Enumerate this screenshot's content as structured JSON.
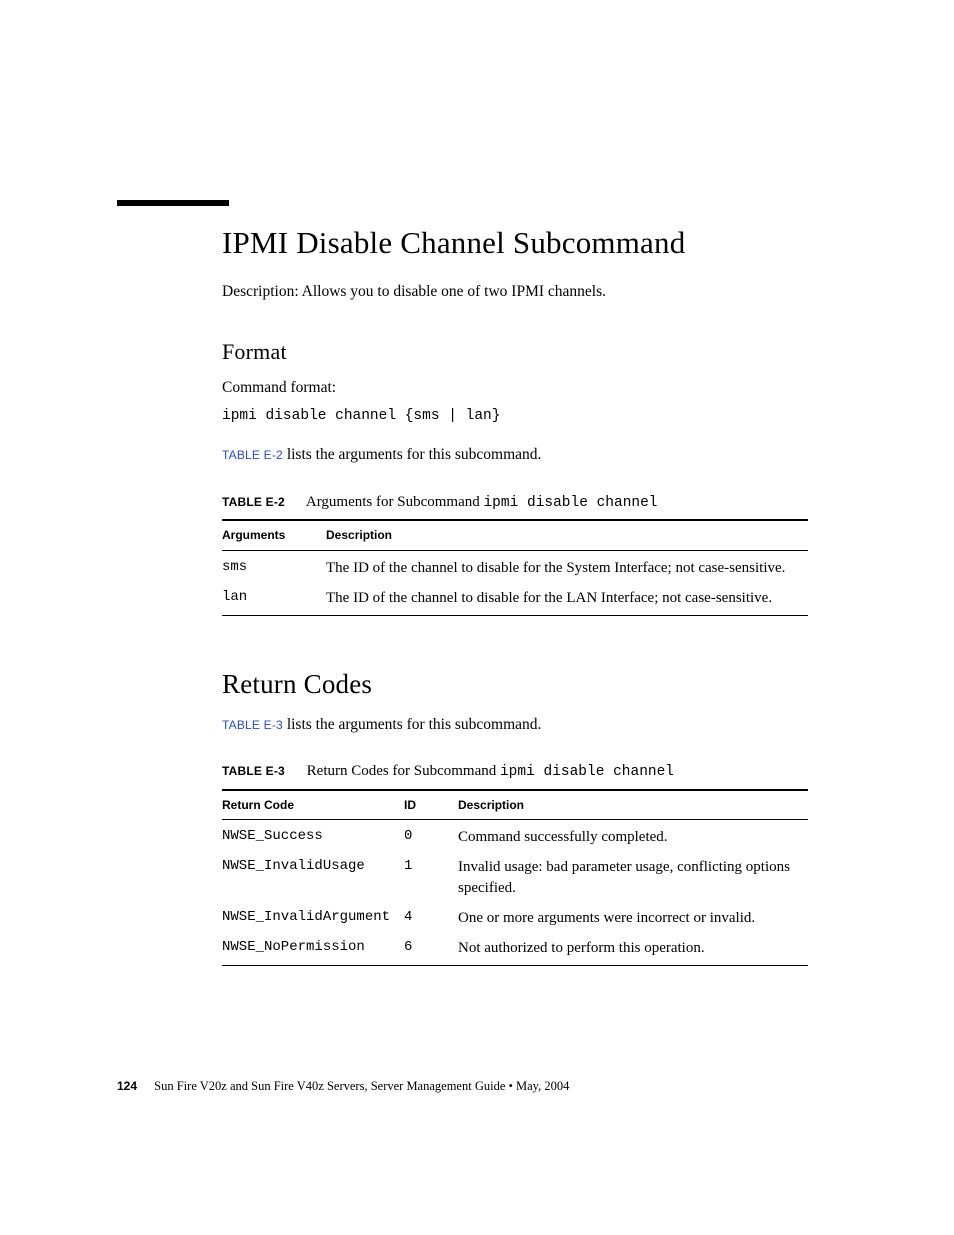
{
  "page": {
    "title": "IPMI Disable Channel Subcommand",
    "description": "Description: Allows you to disable one of two IPMI channels.",
    "footer": {
      "page_number": "124",
      "text": "Sun Fire V20z and Sun Fire V40z Servers, Server Management Guide • May, 2004"
    }
  },
  "format": {
    "heading": "Format",
    "label": "Command format:",
    "command": "ipmi disable channel {sms | lan}",
    "ref_label": "TABLE E-2",
    "ref_tail": " lists the arguments for this subcommand."
  },
  "table_e2": {
    "label": "TABLE E-2",
    "caption_pre": "Arguments for Subcommand ",
    "caption_mono": "ipmi disable channel",
    "headers": {
      "c1": "Arguments",
      "c2": "Description"
    },
    "rows": [
      {
        "arg": "sms",
        "desc": "The ID of the channel to disable for the System Interface; not case-sensitive."
      },
      {
        "arg": "lan",
        "desc": "The ID of the channel to disable for the LAN Interface; not case-sensitive."
      }
    ]
  },
  "return_codes": {
    "heading": "Return Codes",
    "ref_label": "TABLE E-3",
    "ref_tail": " lists the arguments for this subcommand."
  },
  "table_e3": {
    "label": "TABLE E-3",
    "caption_pre": "Return Codes for Subcommand ",
    "caption_mono": "ipmi disable channel",
    "headers": {
      "c1": "Return Code",
      "c2": "ID",
      "c3": "Description"
    },
    "rows": [
      {
        "code": "NWSE_Success",
        "id": "0",
        "desc": "Command successfully completed."
      },
      {
        "code": "NWSE_InvalidUsage",
        "id": "1",
        "desc": "Invalid usage: bad parameter usage, conflicting options specified."
      },
      {
        "code": "NWSE_InvalidArgument",
        "id": "4",
        "desc": "One or more arguments were incorrect or invalid."
      },
      {
        "code": "NWSE_NoPermission",
        "id": "6",
        "desc": "Not authorized to perform this operation."
      }
    ]
  }
}
